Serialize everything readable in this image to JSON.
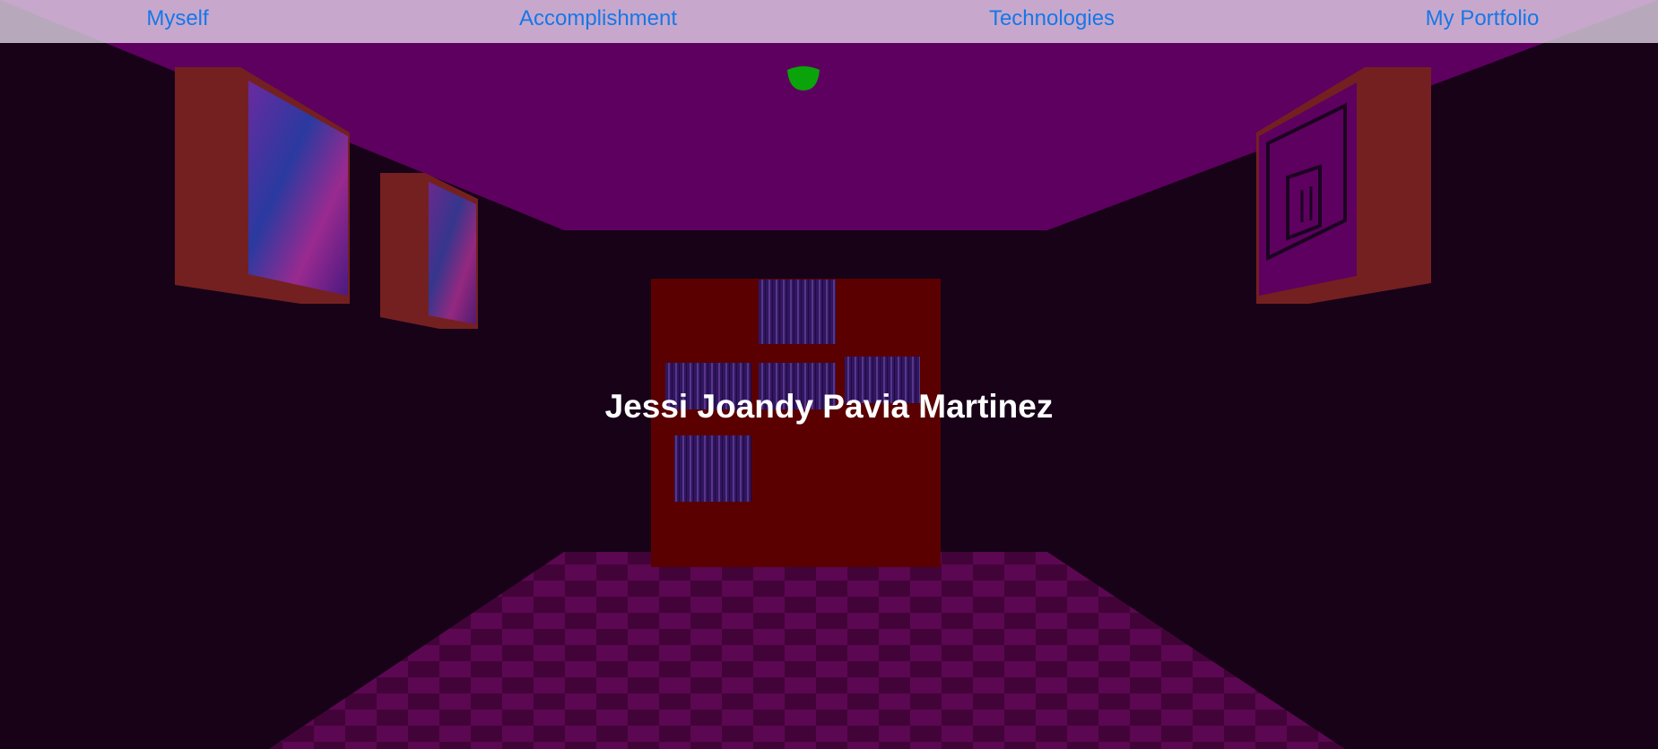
{
  "nav": {
    "items": [
      {
        "label": "Myself"
      },
      {
        "label": "Accomplishment"
      },
      {
        "label": "Technologies"
      },
      {
        "label": "My Portfolio"
      }
    ]
  },
  "hero": {
    "title": "Jessi Joandy Pavia Martinez"
  },
  "scene": {
    "icons": [
      "ceiling-lamp-icon",
      "painting-frame",
      "bookshelf"
    ],
    "colors": {
      "wall": "#170218",
      "ceiling": "#5e005f",
      "frame": "#742020",
      "bookshelf": "#5a0000",
      "lamp": "#0aa40a",
      "link": "#1677e8",
      "floor_light": "#7a0f6e",
      "floor_dark": "#3a0537"
    }
  }
}
